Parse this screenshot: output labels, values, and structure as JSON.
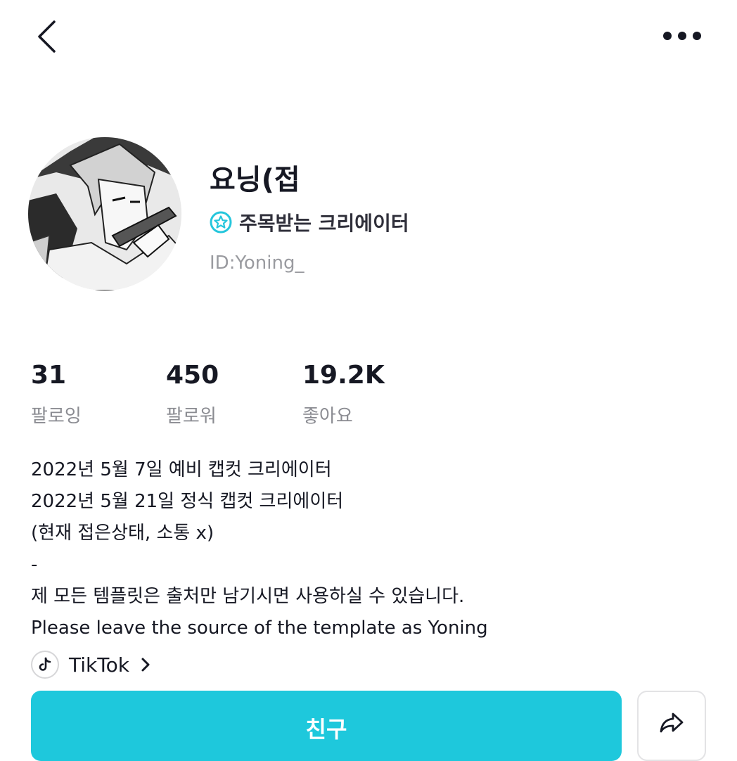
{
  "header": {
    "back_icon": "chevron-left-icon",
    "more_icon": "more-horizontal-icon"
  },
  "profile": {
    "avatar_icon": "avatar-illustration",
    "name": "요닝(접",
    "badge_icon": "star-circle-icon",
    "badge_label": "주목받는 크리에이터",
    "user_id": "ID:Yoning_"
  },
  "stats": [
    {
      "value": "31",
      "label": "팔로잉"
    },
    {
      "value": "450",
      "label": "팔로워"
    },
    {
      "value": "19.2K",
      "label": "좋아요"
    }
  ],
  "bio": {
    "lines": [
      "2022년 5월 7일 예비 캡컷 크리에이터",
      "2022년 5월 21일 정식 캡컷 크리에이터",
      "(현재 접은상태, 소통 x)",
      "-",
      "제 모든 템플릿은 출처만 남기시면 사용하실 수 있습니다.",
      "Please leave the source of the template as Yoning"
    ]
  },
  "link": {
    "icon": "tiktok-icon",
    "label": "TikTok",
    "chevron_icon": "chevron-right-icon"
  },
  "actions": {
    "friend_label": "친구",
    "share_icon": "share-arrow-icon"
  },
  "colors": {
    "accent": "#1ec8dc",
    "badge": "#25c6dc",
    "text_primary": "#161823",
    "text_secondary": "#8a8b91"
  }
}
